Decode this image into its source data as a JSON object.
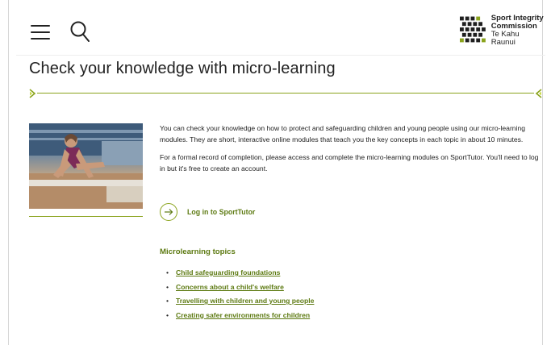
{
  "header": {
    "menu_icon": "hamburger-icon",
    "search_icon": "search-icon",
    "logo": {
      "line1": "Sport Integrity",
      "line2": "Commission",
      "line3": "Te Kahu Raunui"
    }
  },
  "page": {
    "title": "Check your knowledge with micro-learning"
  },
  "content": {
    "paragraph1": "You can check your knowledge on how to protect and safeguarding children and young people using our micro-learning modules. They are short, interactive online modules that teach you the key concepts in each topic in about 10 minutes.",
    "paragraph2": "For a formal record of completion, please access and complete the micro-learning modules on SportTutor. You'll need to log in but it's free to create an account.",
    "cta_label": "Log in to SportTutor"
  },
  "topics": {
    "heading": "Microlearning topics",
    "items": [
      {
        "label": "Child safeguarding foundations"
      },
      {
        "label": "Concerns about a child's welfare"
      },
      {
        "label": "Travelling with children and young people"
      },
      {
        "label": "Creating safer environments for children"
      }
    ]
  },
  "colors": {
    "accent": "#8aa31c",
    "link": "#5d7a12",
    "text": "#222222"
  }
}
